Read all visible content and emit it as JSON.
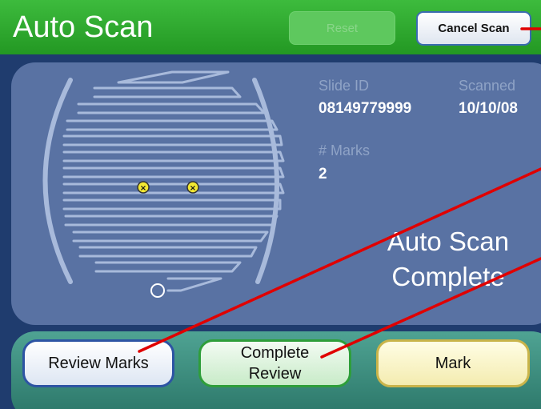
{
  "header": {
    "title": "Auto Scan",
    "reset_label": "Reset",
    "cancel_label": "Cancel Scan"
  },
  "info": {
    "slide_id_label": "Slide ID",
    "slide_id_value": "08149779999",
    "scanned_label": "Scanned",
    "scanned_value": "10/10/08",
    "marks_label": "# Marks",
    "marks_value": "2"
  },
  "status": {
    "line1": "Auto Scan",
    "line2": "Complete"
  },
  "footer": {
    "review_label": "Review Marks",
    "complete_line1": "Complete",
    "complete_line2": "Review",
    "mark_label": "Mark"
  },
  "colors": {
    "header": "#2ea82e",
    "panel": "#5972a3",
    "footer": "#3a8c7e",
    "annotation_line": "#e00000",
    "mark_marker": "#f2e832"
  }
}
